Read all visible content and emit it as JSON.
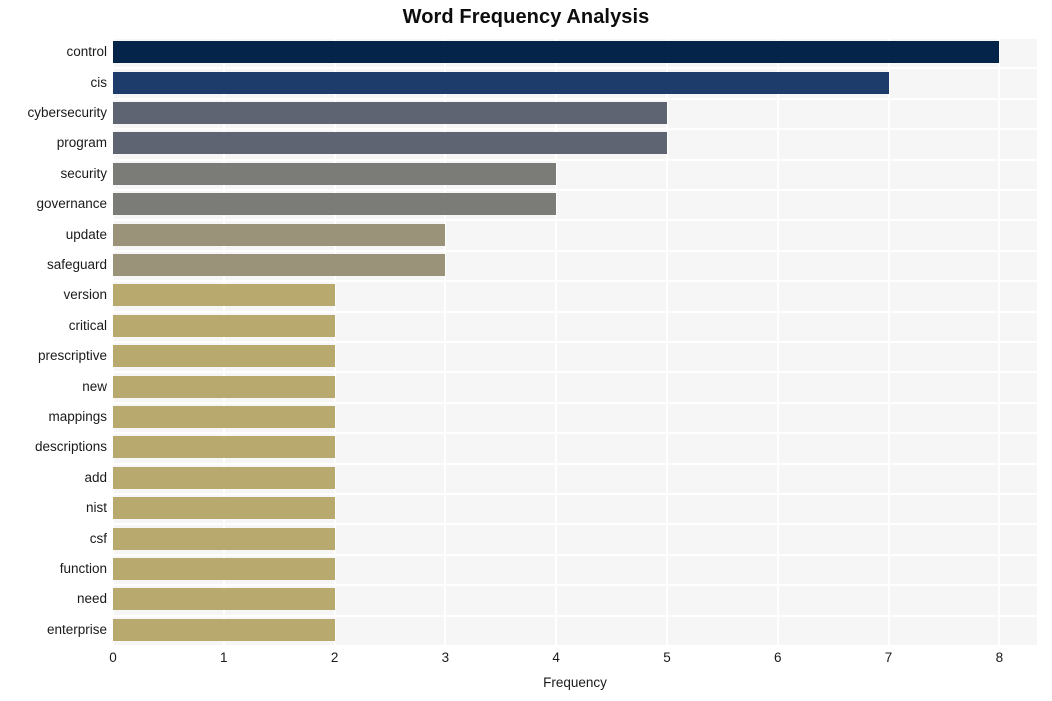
{
  "chart_data": {
    "type": "bar",
    "orientation": "horizontal",
    "title": "Word Frequency Analysis",
    "xlabel": "Frequency",
    "ylabel": "",
    "categories": [
      "control",
      "cis",
      "cybersecurity",
      "program",
      "security",
      "governance",
      "update",
      "safeguard",
      "version",
      "critical",
      "prescriptive",
      "new",
      "mappings",
      "descriptions",
      "add",
      "nist",
      "csf",
      "function",
      "need",
      "enterprise"
    ],
    "values": [
      8,
      7,
      5,
      5,
      4,
      4,
      3,
      3,
      2,
      2,
      2,
      2,
      2,
      2,
      2,
      2,
      2,
      2,
      2,
      2
    ],
    "bar_colors": [
      "#052449",
      "#1d3b6b",
      "#5e6472",
      "#5e6472",
      "#7b7b77",
      "#7b7b77",
      "#9a9379",
      "#9a9379",
      "#b8aa6e",
      "#b8aa6e",
      "#b8aa6e",
      "#b8aa6e",
      "#b8aa6e",
      "#b8aa6e",
      "#b8aa6e",
      "#b8aa6e",
      "#b8aa6e",
      "#b8aa6e",
      "#b8aa6e",
      "#b8aa6e"
    ],
    "xlim": [
      0,
      8.34
    ],
    "xticks": [
      0,
      1,
      2,
      3,
      4,
      5,
      6,
      7,
      8
    ],
    "xtick_labels": [
      "0",
      "1",
      "2",
      "3",
      "4",
      "5",
      "6",
      "7",
      "8"
    ],
    "grid": true,
    "grid_color": "#ffffff",
    "plot_background": "#f6f6f6",
    "figure_background": "#ffffff",
    "legend": null,
    "legend_position": "none"
  }
}
